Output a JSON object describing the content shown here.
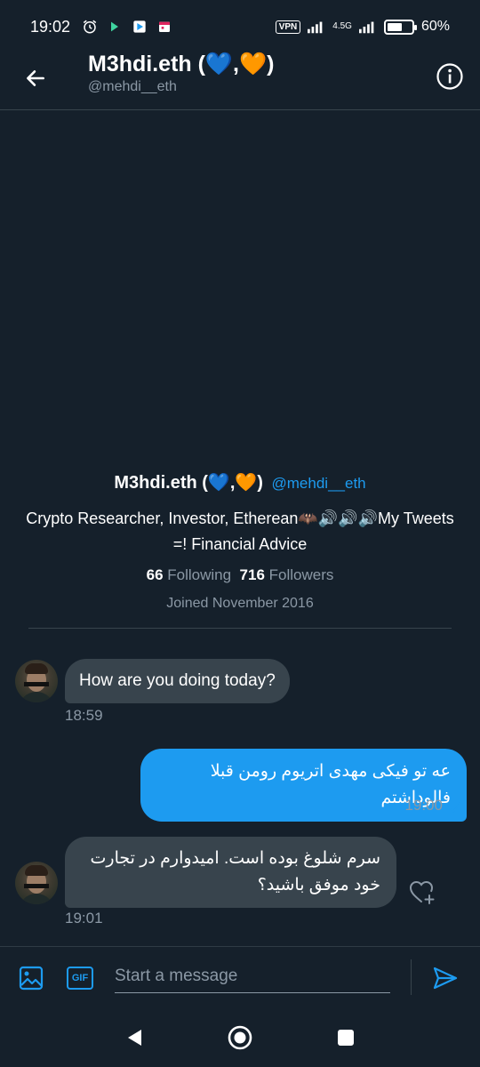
{
  "status_bar": {
    "time": "19:02",
    "vpn": "VPN",
    "network": "4.5G",
    "battery_percent": "60%",
    "battery_level": 0.6
  },
  "header": {
    "title": "M3hdi.eth (💙,🧡)",
    "handle": "@mehdi__eth"
  },
  "profile": {
    "name": "M3hdi.eth (💙,🧡)",
    "handle": "@mehdi__eth",
    "bio": "Crypto Researcher, Investor, Etherean🦇🔊🔊🔊My Tweets =! Financial Advice",
    "following_count": "66",
    "following_label": "Following",
    "followers_count": "716",
    "followers_label": "Followers",
    "joined": "Joined November 2016"
  },
  "messages": [
    {
      "direction": "in",
      "text": "How are you doing today?",
      "time": "18:59"
    },
    {
      "direction": "out",
      "text": "عه تو فیکی مهدی اتریوم رومن قبلا فالوداشتم",
      "time": "19:00"
    },
    {
      "direction": "in",
      "text": "سرم شلوغ بوده است. امیدوارم در تجارت خود موفق باشید؟",
      "time": "19:01"
    }
  ],
  "composer": {
    "placeholder": "Start a message",
    "gif_label": "GIF"
  },
  "colors": {
    "background": "#15202b",
    "accent": "#1d9bf0",
    "bubble_in": "#38444d",
    "secondary_text": "#8b98a5"
  }
}
